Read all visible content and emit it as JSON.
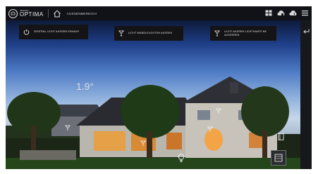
{
  "header": {
    "logo_small": "SMARTE",
    "logo_main": "OPTIMA",
    "page_title": "AUSSENBEREICH"
  },
  "scenes": [
    {
      "label": "ZENTRAL LICHT AUSSEN EIN/AUS"
    },
    {
      "label": "LICHT WANDLEUCHTEN AUSSEN"
    },
    {
      "label_line1": "LICHT AUSSEN LICHTKANTE BE",
      "label_line2": "AUSSEREN"
    }
  ],
  "weather": {
    "temperature": "1.9°"
  },
  "icons": {
    "logo": "smart-optima-logo",
    "home": "home-icon",
    "top_right": [
      "grid-icon",
      "cloud-icon",
      "cloud-alert-icon",
      "menu-icon"
    ],
    "back": "back-arrow-icon",
    "scene_power": "power-icon",
    "scene_lamp": "lamp-icon",
    "hotspots": [
      "lamp-icon",
      "lamp-icon",
      "lamp-icon",
      "lamp-icon",
      "bulb-icon",
      "door-icon",
      "window-shutter-icon"
    ]
  },
  "colors": {
    "topbar": "#111217",
    "scene_button": "#141416",
    "accent_text": "#e6e6e6"
  }
}
